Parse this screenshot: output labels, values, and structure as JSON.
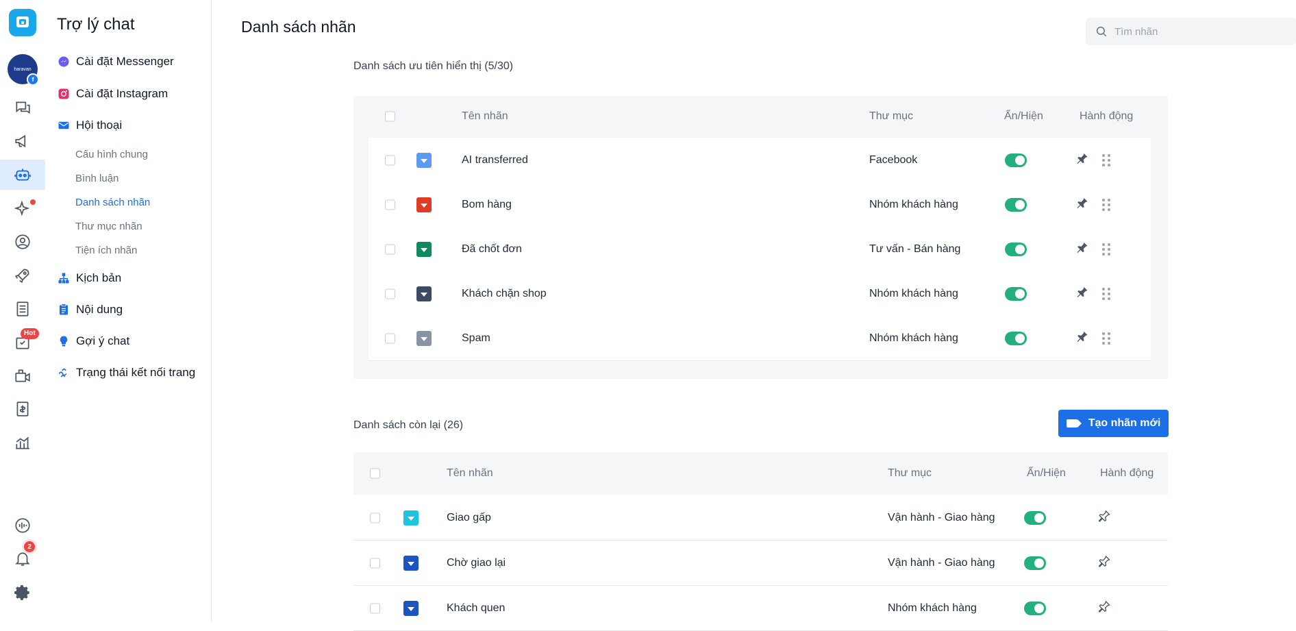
{
  "sidebar": {
    "title": "Trợ lý chat",
    "items": [
      {
        "label": "Cài đặt Messenger"
      },
      {
        "label": "Cài đặt Instagram"
      },
      {
        "label": "Hội thoại"
      },
      {
        "label": "Kịch bản"
      },
      {
        "label": "Nội dung"
      },
      {
        "label": "Gợi ý chat"
      },
      {
        "label": "Trạng thái kết nối trang"
      }
    ],
    "sub_items": [
      {
        "label": "Cấu hình chung"
      },
      {
        "label": "Bình luận"
      },
      {
        "label": "Danh sách nhãn",
        "active": true
      },
      {
        "label": "Thư mục nhãn"
      },
      {
        "label": "Tiện ích nhãn"
      }
    ]
  },
  "rail": {
    "avatar_text": "haravan",
    "hot_badge": "Hot",
    "notification_count": "2"
  },
  "header": {
    "title": "Danh sách nhãn",
    "search_placeholder": "Tìm nhãn"
  },
  "priority": {
    "label": "Danh sách ưu tiên hiển thị (5/30)",
    "columns": {
      "name": "Tên nhãn",
      "folder": "Thư mục",
      "visibility": "Ẩn/Hiện",
      "action": "Hành động"
    },
    "rows": [
      {
        "name": "AI transferred",
        "folder": "Facebook",
        "color": "#5b9cf0"
      },
      {
        "name": "Bom hàng",
        "folder": "Nhóm khách hàng",
        "color": "#e03b24"
      },
      {
        "name": "Đã chốt đơn",
        "folder": "Tư vấn - Bán hàng",
        "color": "#0f8a5f"
      },
      {
        "name": "Khách chặn shop",
        "folder": "Nhóm khách hàng",
        "color": "#3d4a66"
      },
      {
        "name": "Spam",
        "folder": "Nhóm khách hàng",
        "color": "#8a93a3"
      }
    ]
  },
  "rest": {
    "label": "Danh sách còn lại (26)",
    "create_button": "Tạo nhãn mới",
    "columns": {
      "name": "Tên nhãn",
      "folder": "Thư mục",
      "visibility": "Ẩn/Hiện",
      "action": "Hành động"
    },
    "rows": [
      {
        "name": "Giao gấp",
        "folder": "Vận hành - Giao hàng",
        "color": "#1cc4de"
      },
      {
        "name": "Chờ giao lại",
        "folder": "Vận hành - Giao hàng",
        "color": "#1b55c4"
      },
      {
        "name": "Khách quen",
        "folder": "Nhóm khách hàng",
        "color": "#1b55c4"
      }
    ]
  },
  "colors": {
    "accent": "#1d6fe8",
    "toggle_on": "#22b07d",
    "badge": "#ef4444"
  }
}
